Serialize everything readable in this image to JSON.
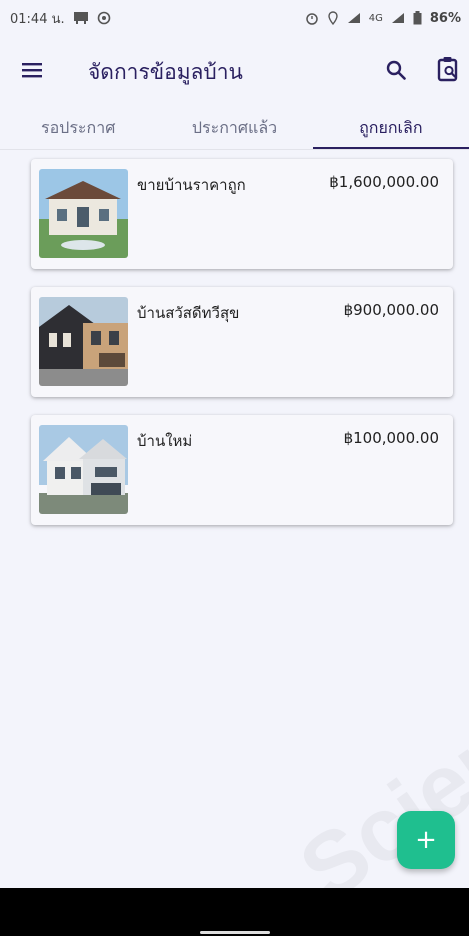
{
  "status_bar": {
    "time": "01:44 น.",
    "network": "4G",
    "battery": "86%"
  },
  "app_bar": {
    "title": "จัดการข้อมูลบ้าน",
    "menu_icon": "menu-icon",
    "search_icon": "search-icon",
    "clipboard_icon": "clipboard-search-icon"
  },
  "tabs": [
    {
      "label": "รอประกาศ",
      "active": false
    },
    {
      "label": "ประกาศแล้ว",
      "active": false
    },
    {
      "label": "ถูกยกเลิก",
      "active": true
    }
  ],
  "listings": [
    {
      "name": "ขายบ้านราคาถูก",
      "price": "฿1,600,000.00"
    },
    {
      "name": "บ้านสวัสดีทวีสุข",
      "price": "฿900,000.00"
    },
    {
      "name": "บ้านใหม่",
      "price": "฿100,000.00"
    }
  ],
  "fab": {
    "label": "+"
  },
  "watermark": "Scien",
  "colors": {
    "background": "#f3f4fb",
    "primary": "#2a2060",
    "accent": "#1fbf8f"
  }
}
